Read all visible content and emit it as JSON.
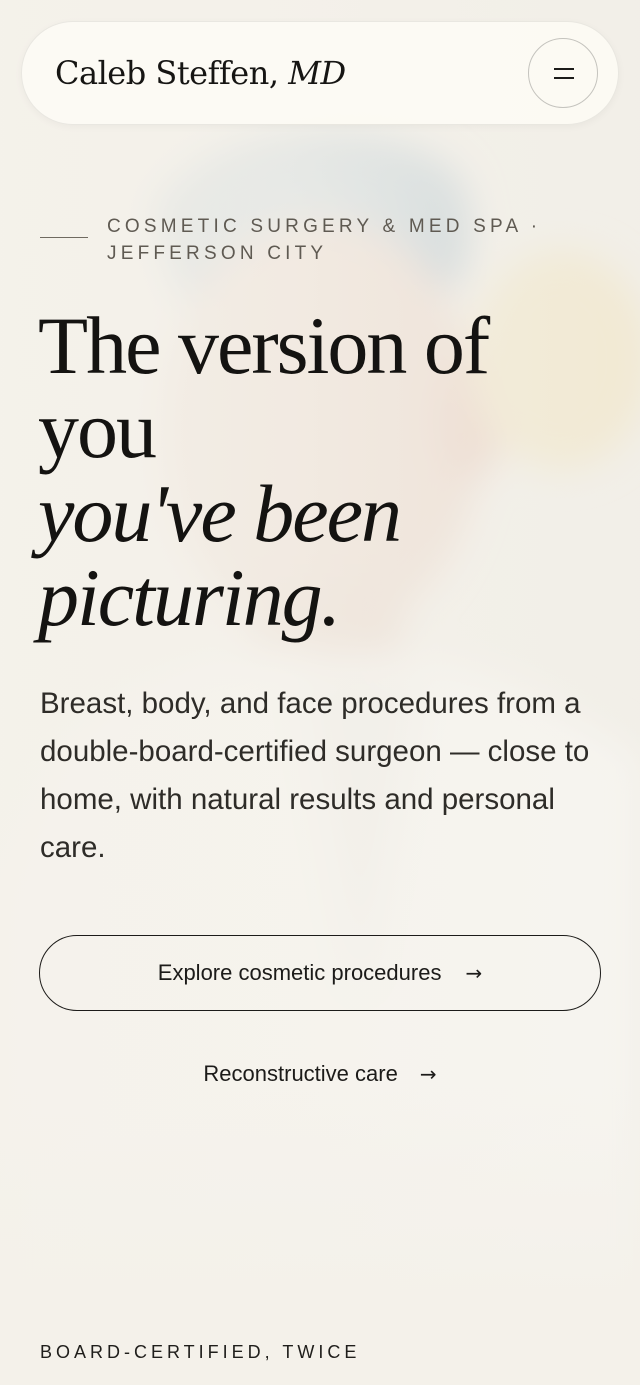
{
  "header": {
    "brand_name": "Caleb Steffen,",
    "brand_credential": "MD",
    "menu_icon": "hamburger-menu-icon"
  },
  "hero": {
    "eyebrow": "COSMETIC SURGERY & MED SPA · JEFFERSON CITY",
    "headline_line1": "The version of",
    "headline_line2": "you",
    "headline_italic_line1": "you've been",
    "headline_italic_line2": "picturing.",
    "lede": "Breast, body, and face procedures from a double-board-certified surgeon — close to home, with natural results and personal care.",
    "cta_primary_label": "Explore cosmetic procedures",
    "cta_secondary_label": "Reconstructive care",
    "arrow_glyph": "→"
  },
  "credentials": {
    "eyebrow": "BOARD-CERTIFIED, TWICE"
  },
  "colors": {
    "background": "#f3f0e9",
    "text": "#1c1b19",
    "muted": "#5f5a52"
  }
}
